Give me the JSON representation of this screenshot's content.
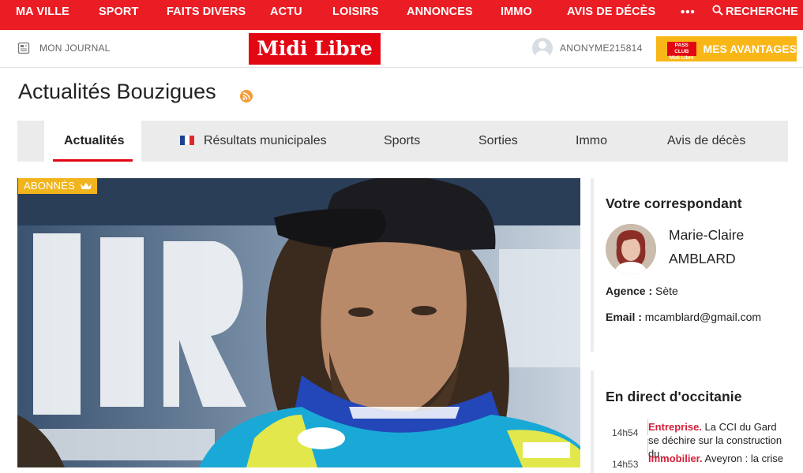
{
  "topnav": {
    "items": [
      "MA VILLE",
      "SPORT",
      "FAITS DIVERS",
      "ACTU",
      "LOISIRS",
      "ANNONCES",
      "IMMO",
      "AVIS DE DÉCÈS"
    ],
    "more": "•••",
    "search": "RECHERCHE"
  },
  "header": {
    "journal": "MON JOURNAL",
    "logo": "Midi Libre",
    "user": "ANONYME215814",
    "passclub_line1": "PASS CLUB",
    "passclub_line2": "Midi Libre",
    "advantages": "MES AVANTAGES"
  },
  "page": {
    "title": "Actualités Bouzigues"
  },
  "tabs": [
    {
      "label": "Actualités",
      "active": true
    },
    {
      "label": "Résultats municipales",
      "active": false
    },
    {
      "label": "Sports",
      "active": false
    },
    {
      "label": "Sorties",
      "active": false
    },
    {
      "label": "Immo",
      "active": false
    },
    {
      "label": "Avis de décès",
      "active": false
    }
  ],
  "hero": {
    "badge": "ABONNÉS"
  },
  "correspondant": {
    "title": "Votre correspondant",
    "first_name": "Marie-Claire",
    "last_name": "AMBLARD",
    "agence_label": "Agence :",
    "agence": "Sète",
    "email_label": "Email :",
    "email": "mcamblard@gmail.com"
  },
  "direct": {
    "title": "En direct d'occitanie",
    "items": [
      {
        "time": "14h54",
        "category": "Entreprise.",
        "text": "La CCI du Gard se déchire sur la construction du..."
      },
      {
        "time": "14h53",
        "category": "Immobilier.",
        "text": "Aveyron : la crise"
      }
    ]
  },
  "colors": {
    "brand_red": "#ea1c24",
    "accent_yellow": "#f8b617",
    "tab_bg": "#ebebeb"
  }
}
